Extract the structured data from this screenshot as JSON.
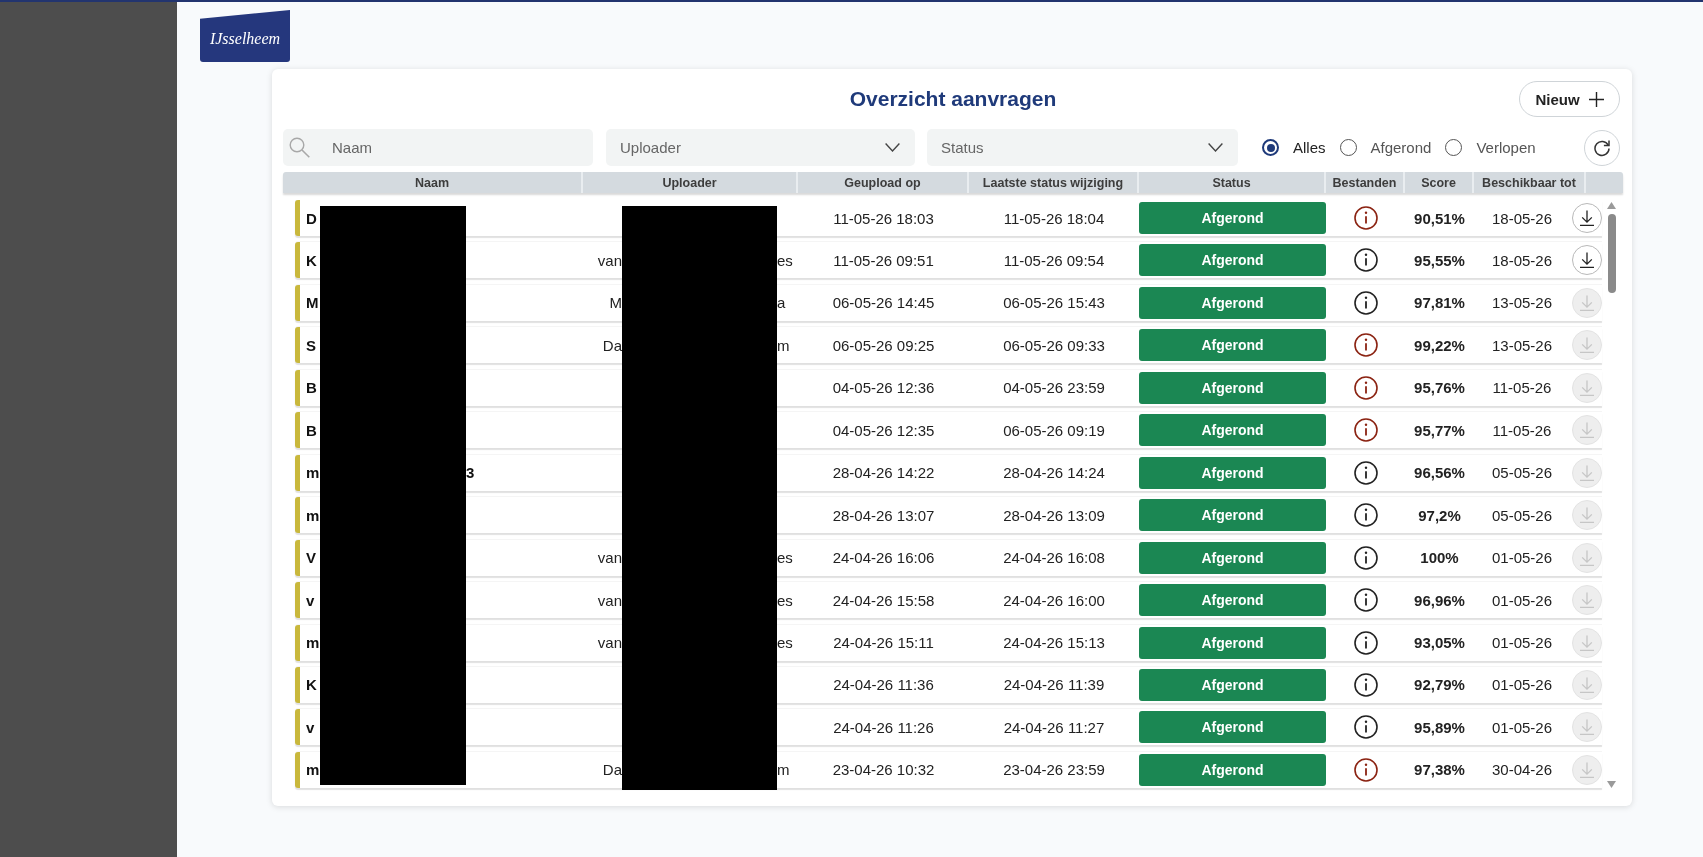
{
  "logo": {
    "text": "IJsselheem"
  },
  "panel": {
    "title": "Overzicht aanvragen",
    "new_button": {
      "label": "Nieuw"
    }
  },
  "filters": {
    "search": {
      "placeholder": "Naam"
    },
    "uploader": {
      "placeholder": "Uploader"
    },
    "status": {
      "placeholder": "Status"
    },
    "options": [
      {
        "label": "Alles",
        "selected": true
      },
      {
        "label": "Afgerond",
        "selected": false
      },
      {
        "label": "Verlopen",
        "selected": false
      }
    ]
  },
  "table": {
    "columns": [
      "Naam",
      "Uploader",
      "Geupload op",
      "Laatste status wijziging",
      "Status",
      "Bestanden",
      "Score",
      "Beschikbaar tot"
    ],
    "rows": [
      {
        "name": [
          "D"
        ],
        "uploaded": "11-05-26 18:03",
        "status_changed": "11-05-26 18:04",
        "status": "Afgerond",
        "files_info": {
          "color": "#8b2312"
        },
        "score": "90,51%",
        "available_until": "18-05-26",
        "download": {
          "disabled": false
        }
      },
      {
        "name": [
          "K"
        ],
        "uploader": [
          "van",
          "es"
        ],
        "uploaded": "11-05-26 09:51",
        "status_changed": "11-05-26 09:54",
        "status": "Afgerond",
        "files_info": {
          "color": "#222222"
        },
        "score": "95,55%",
        "available_until": "18-05-26",
        "download": {
          "disabled": false
        }
      },
      {
        "name": [
          "M"
        ],
        "uploader": [
          "M",
          "a"
        ],
        "uploaded": "06-05-26 14:45",
        "status_changed": "06-05-26 15:43",
        "status": "Afgerond",
        "files_info": {
          "color": "#222222"
        },
        "score": "97,81%",
        "available_until": "13-05-26",
        "download": {
          "disabled": true
        }
      },
      {
        "name": [
          "S"
        ],
        "uploader": [
          "Da",
          "m"
        ],
        "uploaded": "06-05-26 09:25",
        "status_changed": "06-05-26 09:33",
        "status": "Afgerond",
        "files_info": {
          "color": "#8b2312"
        },
        "score": "99,22%",
        "available_until": "13-05-26",
        "download": {
          "disabled": true
        }
      },
      {
        "name": [
          "B"
        ],
        "uploaded": "04-05-26 12:36",
        "status_changed": "04-05-26 23:59",
        "status": "Afgerond",
        "files_info": {
          "color": "#8b2312"
        },
        "score": "95,76%",
        "available_until": "11-05-26",
        "download": {
          "disabled": true
        }
      },
      {
        "name": [
          "B"
        ],
        "uploaded": "04-05-26 12:35",
        "status_changed": "06-05-26 09:19",
        "status": "Afgerond",
        "files_info": {
          "color": "#8b2312"
        },
        "score": "95,77%",
        "available_until": "11-05-26",
        "download": {
          "disabled": true
        }
      },
      {
        "name": [
          "m",
          "3"
        ],
        "uploaded": "28-04-26 14:22",
        "status_changed": "28-04-26 14:24",
        "status": "Afgerond",
        "files_info": {
          "color": "#222222"
        },
        "score": "96,56%",
        "available_until": "05-05-26",
        "download": {
          "disabled": true
        }
      },
      {
        "name": [
          "m"
        ],
        "uploaded": "28-04-26 13:07",
        "status_changed": "28-04-26 13:09",
        "status": "Afgerond",
        "files_info": {
          "color": "#222222"
        },
        "score": "97,2%",
        "available_until": "05-05-26",
        "download": {
          "disabled": true
        }
      },
      {
        "name": [
          "V"
        ],
        "uploader": [
          "van",
          "es"
        ],
        "uploaded": "24-04-26 16:06",
        "status_changed": "24-04-26 16:08",
        "status": "Afgerond",
        "files_info": {
          "color": "#222222"
        },
        "score": "100%",
        "available_until": "01-05-26",
        "download": {
          "disabled": true
        }
      },
      {
        "name": [
          "v"
        ],
        "uploader": [
          "van",
          "es"
        ],
        "uploaded": "24-04-26 15:58",
        "status_changed": "24-04-26 16:00",
        "status": "Afgerond",
        "files_info": {
          "color": "#222222"
        },
        "score": "96,96%",
        "available_until": "01-05-26",
        "download": {
          "disabled": true
        }
      },
      {
        "name": [
          "m"
        ],
        "uploader": [
          "van",
          "es"
        ],
        "uploaded": "24-04-26 15:11",
        "status_changed": "24-04-26 15:13",
        "status": "Afgerond",
        "files_info": {
          "color": "#222222"
        },
        "score": "93,05%",
        "available_until": "01-05-26",
        "download": {
          "disabled": true
        }
      },
      {
        "name": [
          "K"
        ],
        "uploaded": "24-04-26 11:36",
        "status_changed": "24-04-26 11:39",
        "status": "Afgerond",
        "files_info": {
          "color": "#222222"
        },
        "score": "92,79%",
        "available_until": "01-05-26",
        "download": {
          "disabled": true
        }
      },
      {
        "name": [
          "v"
        ],
        "uploaded": "24-04-26 11:26",
        "status_changed": "24-04-26 11:27",
        "status": "Afgerond",
        "files_info": {
          "color": "#222222"
        },
        "score": "95,89%",
        "available_until": "01-05-26",
        "download": {
          "disabled": true
        }
      },
      {
        "name": [
          "m"
        ],
        "uploader": [
          "Da",
          "m"
        ],
        "uploaded": "23-04-26 10:32",
        "status_changed": "23-04-26 23:59",
        "status": "Afgerond",
        "files_info": {
          "color": "#8b2312"
        },
        "score": "97,38%",
        "available_until": "30-04-26",
        "download": {
          "disabled": true
        }
      }
    ]
  }
}
